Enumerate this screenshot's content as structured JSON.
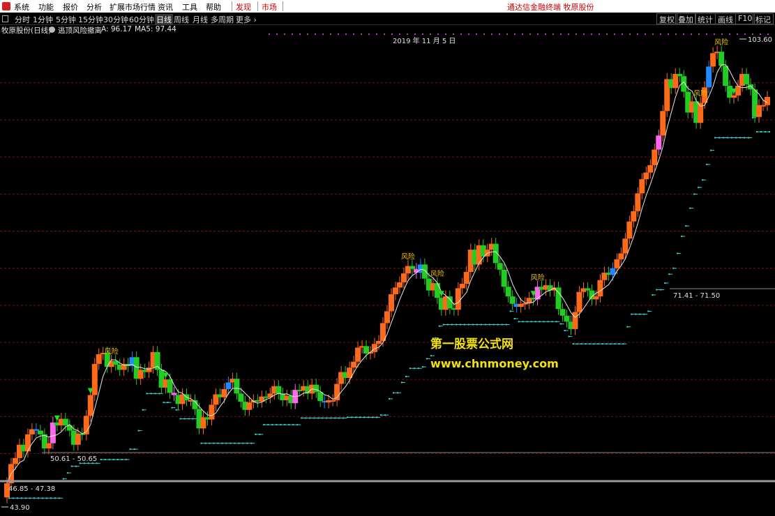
{
  "menubar": {
    "items": [
      "系统",
      "功能",
      "报价",
      "分析",
      "扩展市场行情",
      "资讯",
      "工具",
      "帮助"
    ],
    "highlight_items": [
      "发现",
      "市场"
    ],
    "right_title": "通达信金融终端  牧原股份"
  },
  "toolbar": {
    "periods": [
      "分时",
      "1分钟",
      "5分钟",
      "15分钟",
      "30分钟",
      "60分钟",
      "日线",
      "周线",
      "月线",
      "多周期",
      "更多 ›"
    ],
    "active_period": "日线",
    "right_buttons": [
      "复权",
      "叠加",
      "统计",
      "画线",
      "F10",
      "标记"
    ]
  },
  "info": {
    "stock": "牧原股份(日线)",
    "indicator": "逃顶风险撤离",
    "a_label": "A: 96.17",
    "ma5_label": "MA5: 97.44"
  },
  "date_label": "2019 年 11 月 5 日",
  "price_labels": {
    "high": "103.60",
    "mid_right": "71.41 - 71.50",
    "mid_left": "50.61 - 50.65",
    "low_range": "46.85 - 47.38",
    "low": "43.90"
  },
  "risk_label": "风险",
  "watermark": {
    "title": "第一股票公式网",
    "url": "www.chnmoney.com"
  },
  "colors": {
    "up": "#ff6a1a",
    "down": "#22cc22",
    "blue": "#2288ff",
    "pink": "#ff66ee",
    "gridline": "#7a1010",
    "watermark": "#f2e20a"
  },
  "chart_data": {
    "type": "candlestick",
    "x": [
      0,
      1,
      2,
      3,
      4,
      5,
      6,
      7,
      8,
      9,
      10,
      11,
      12,
      13,
      14,
      15,
      16,
      17,
      18,
      19,
      20,
      21,
      22,
      23,
      24,
      25,
      26,
      27,
      28,
      29,
      30,
      31,
      32,
      33,
      34,
      35,
      36,
      37,
      38,
      39,
      40,
      41,
      42,
      43,
      44,
      45,
      46,
      47,
      48,
      49,
      50,
      51,
      52,
      53,
      54,
      55,
      56,
      57,
      58,
      59,
      60,
      61,
      62,
      63,
      64,
      65,
      66,
      67,
      68,
      69,
      70,
      71,
      72,
      73,
      74,
      75,
      76,
      77,
      78,
      79,
      80,
      81,
      82,
      83,
      84,
      85,
      86,
      87,
      88,
      89,
      90,
      91,
      92,
      93,
      94,
      95,
      96,
      97,
      98,
      99,
      100,
      101,
      102,
      103,
      104,
      105,
      106,
      107,
      108,
      109,
      110,
      111,
      112,
      113,
      114,
      115,
      116,
      117,
      118,
      119,
      120,
      121,
      122,
      123,
      124,
      125,
      126,
      127,
      128,
      129,
      130,
      131,
      132,
      133,
      134,
      135,
      136,
      137,
      138,
      139,
      140,
      141,
      142,
      143,
      144,
      145,
      146,
      147,
      148,
      149,
      150,
      151,
      152,
      153,
      154,
      155,
      156,
      157,
      158,
      159,
      160,
      161,
      162,
      163,
      164,
      165,
      166,
      167,
      168,
      169,
      170,
      171,
      172,
      173,
      174,
      175,
      176,
      177,
      178,
      179,
      180,
      181
    ],
    "open": [
      44.1,
      46.0,
      48.6,
      49.4,
      51.2,
      50.3,
      52.6,
      53.3,
      53.1,
      52.6,
      50.7,
      51.4,
      54.2,
      53.8,
      54.7,
      53.8,
      53.1,
      51.2,
      52.7,
      52.6,
      55.1,
      57.9,
      62.1,
      63.4,
      63.6,
      61.7,
      62.5,
      62.0,
      61.3,
      62.1,
      61.8,
      63.0,
      60.1,
      61.3,
      61.0,
      61.6,
      63.7,
      61.3,
      58.9,
      60.0,
      58.2,
      57.9,
      56.7,
      58.0,
      57.2,
      57.2,
      56.0,
      53.4,
      54.9,
      54.6,
      56.6,
      58.0,
      57.6,
      58.7,
      59.6,
      60.1,
      58.1,
      57.0,
      55.9,
      56.9,
      57.2,
      57.0,
      57.7,
      57.6,
      58.1,
      59.1,
      58.1,
      57.2,
      57.8,
      56.8,
      58.6,
      58.5,
      59.1,
      58.1,
      59.3,
      58.3,
      57.1,
      56.9,
      57.2,
      57.2,
      59.4,
      61.0,
      60.2,
      61.6,
      62.4,
      64.3,
      64.5,
      63.5,
      63.7,
      64.8,
      65.2,
      67.6,
      69.2,
      71.5,
      72.4,
      73.1,
      74.3,
      75.3,
      74.9,
      74.4,
      75.5,
      73.6,
      72.0,
      73.0,
      71.0,
      69.4,
      71.2,
      69.6,
      69.4,
      72.3,
      72.9,
      74.5,
      77.5,
      75.5,
      78.1,
      76.6,
      77.5,
      78.3,
      75.7,
      74.8,
      72.5,
      71.2,
      70.2,
      69.8,
      70.2,
      70.3,
      71.0,
      70.8,
      72.5,
      72.1,
      72.7,
      72.0,
      72.4,
      69.5,
      68.6,
      67.8,
      66.8,
      69.1,
      71.8,
      72.3,
      72.0,
      70.8,
      71.2,
      73.4,
      74.4,
      74.1,
      75.0,
      76.2,
      77.0,
      79.0,
      81.3,
      82.7,
      85.1,
      87.0,
      87.9,
      88.9,
      91.0,
      92.9,
      96.2,
      100.5,
      99.3,
      101.2,
      100.9,
      98.8,
      96.0,
      97.5,
      94.6,
      97.3,
      99.4,
      102.2,
      104.0,
      104.2,
      102.3,
      99.6,
      98.0,
      98.3,
      99.6,
      101.2,
      99.8,
      99.1,
      95.4,
      97.0,
      97.0
    ],
    "close": [
      46.0,
      48.6,
      49.4,
      51.2,
      50.3,
      52.6,
      53.3,
      53.1,
      52.6,
      50.7,
      51.4,
      54.2,
      53.8,
      54.7,
      53.8,
      53.1,
      51.2,
      52.7,
      52.6,
      55.1,
      57.9,
      62.1,
      63.4,
      63.6,
      61.7,
      62.5,
      62.0,
      61.3,
      62.1,
      61.8,
      63.0,
      60.1,
      61.3,
      61.0,
      61.6,
      63.7,
      61.3,
      58.9,
      60.0,
      58.2,
      57.9,
      56.7,
      58.0,
      57.2,
      57.2,
      56.0,
      53.4,
      54.9,
      54.6,
      56.6,
      58.0,
      57.6,
      58.7,
      59.6,
      60.1,
      58.1,
      57.0,
      55.9,
      56.9,
      57.2,
      57.0,
      57.7,
      57.6,
      58.1,
      59.1,
      58.1,
      57.2,
      57.8,
      56.8,
      58.6,
      58.5,
      59.1,
      58.1,
      59.3,
      58.3,
      57.1,
      56.9,
      57.2,
      57.2,
      59.4,
      61.0,
      60.2,
      61.6,
      62.4,
      64.3,
      64.5,
      63.5,
      63.7,
      64.8,
      65.2,
      67.6,
      69.2,
      71.5,
      72.4,
      73.1,
      74.3,
      75.3,
      74.9,
      74.4,
      75.5,
      73.6,
      72.0,
      73.0,
      71.0,
      69.4,
      71.2,
      69.6,
      69.4,
      72.3,
      72.9,
      74.5,
      77.5,
      75.5,
      78.1,
      76.6,
      77.5,
      78.3,
      75.7,
      74.8,
      72.5,
      71.2,
      70.2,
      69.8,
      70.2,
      70.3,
      71.0,
      70.8,
      72.5,
      72.1,
      72.7,
      72.0,
      72.4,
      69.5,
      68.6,
      67.8,
      66.8,
      69.1,
      71.8,
      72.3,
      72.0,
      70.8,
      71.2,
      73.4,
      74.4,
      74.1,
      75.0,
      76.2,
      77.0,
      79.0,
      81.3,
      82.7,
      85.1,
      87.0,
      87.9,
      88.9,
      91.0,
      92.9,
      96.2,
      100.5,
      99.3,
      101.2,
      100.9,
      98.8,
      96.0,
      97.5,
      94.6,
      97.3,
      99.4,
      102.2,
      104.0,
      104.2,
      102.3,
      99.6,
      98.0,
      98.3,
      99.6,
      101.2,
      99.8,
      99.1,
      95.4,
      97.0,
      97.0,
      98.1
    ],
    "ylim": [
      43.0,
      106.0
    ]
  }
}
